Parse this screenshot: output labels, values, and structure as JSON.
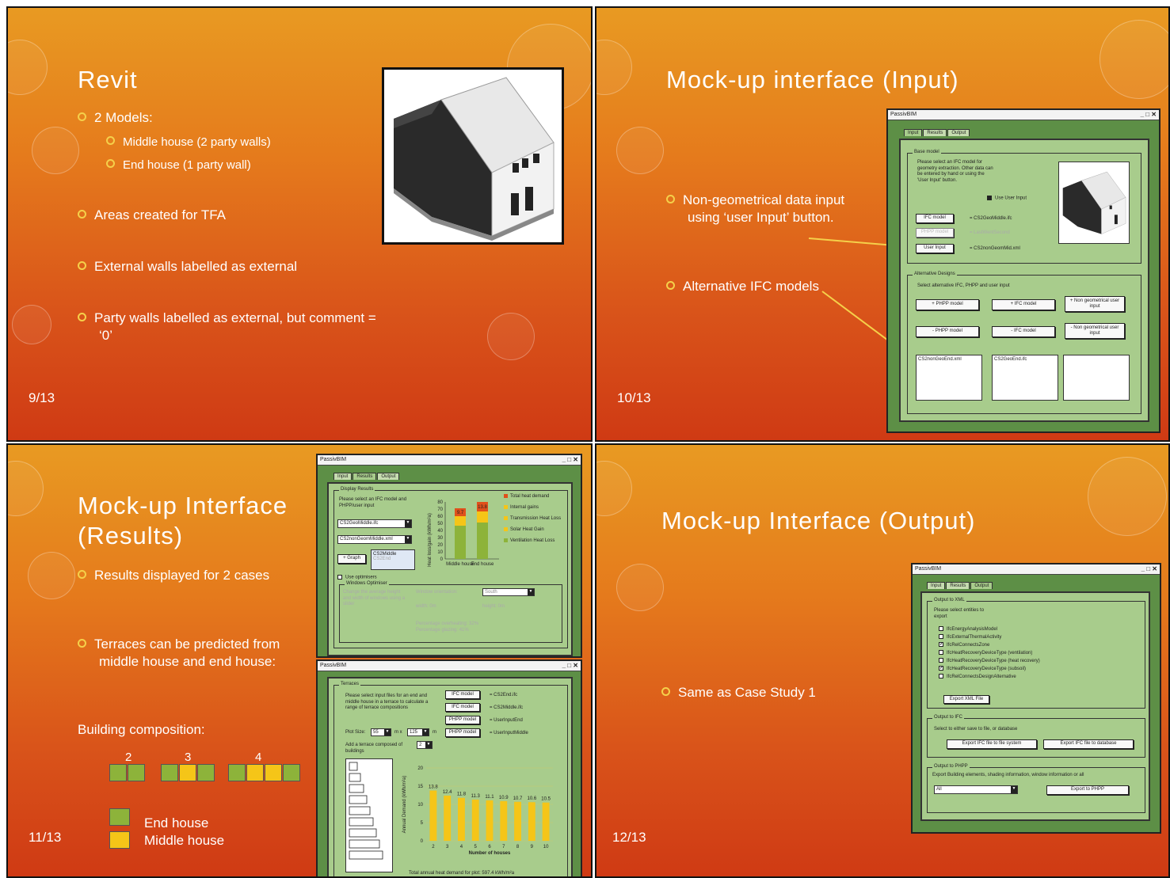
{
  "slide1": {
    "title": "Revit",
    "bullets": [
      "2 Models:",
      "Areas created for TFA",
      "External walls labelled as external",
      "Party walls labelled as external, but comment = ‘0’"
    ],
    "sub_bullets": [
      "Middle house (2 party walls)",
      "End house (1 party wall)"
    ],
    "page": "9/13"
  },
  "slide2": {
    "title": "Mock-up interface (Input)",
    "bullets": [
      "Non-geometrical data input using ‘user Input’ button.",
      "Alternative IFC models"
    ],
    "page": "10/13",
    "window": {
      "app": "PassivBIM",
      "controls": "_ □ ✕",
      "tabs": [
        "Input",
        "Results",
        "Output"
      ],
      "base_group": "Base model",
      "base_text": "Please select an IFC model for geometry extraction. Other data can be entered by hand or using the 'User Input' button.",
      "use_user_input": "Use User Input",
      "ifc_btn": "IFC model",
      "ifc_val": "= CS2GeoMiddle.ifc",
      "phpp_btn": "PHPP model",
      "phpp_val": "= LastWentSecond",
      "user_btn": "User Input",
      "user_val": "= CS2nonGeomMid.xml",
      "alt_group": "Alternative Designs",
      "alt_text": "Select alternative IFC, PHPP and user input",
      "add_phpp": "+ PHPP model",
      "add_ifc": "+ IFC model",
      "add_ng": "+ Non geometrical user input",
      "rem_phpp": "- PHPP model",
      "rem_ifc": "- IFC model",
      "rem_ng": "- Non geometrical user input",
      "list1": "CS2nonGeoEnd.xml",
      "list2": "CS2GeoEnd.ifc"
    }
  },
  "slide3": {
    "title_line1": "Mock-up Interface",
    "title_line2": "(Results)",
    "bullets": [
      "Results displayed for 2 cases",
      "Terraces can be predicted from middle house and end house:"
    ],
    "composition_label": "Building composition:",
    "comp_numbers": [
      "2",
      "3",
      "4"
    ],
    "legend": [
      "End house",
      "Middle house"
    ],
    "legend_colors": [
      "#8db33a",
      "#f5c518"
    ],
    "page": "11/13",
    "win1": {
      "app": "PassivBIM",
      "controls": "_ □ ✕",
      "tabs": [
        "Input",
        "Results",
        "Output"
      ],
      "group": "Display Results",
      "text": "Please select an IFC model and PHPP/user input",
      "sel1": "CS2GeoMiddle.ifc",
      "sel2": "CS2nonGeomMiddle.xml",
      "graph_btn": "+ Graph",
      "list_a": "CS2Middle",
      "list_b": "CS2End",
      "use_opt": "Use optimisers",
      "opt_group": "Windows Optimiser",
      "opt_text": "Change the average height and width of windows using a slider",
      "orient_label": "Window orientation:",
      "orient_val": "South",
      "width_label": "width: 0m",
      "height_label": "height: 0m",
      "pct_overheat": "Percentage overheating: 32%",
      "pct_glazing": "Percentage glazing: 41%",
      "ylabel": "Heat loss/gain (kWh/m²a)",
      "yticks": [
        "80",
        "70",
        "60",
        "50",
        "40",
        "30",
        "20",
        "10",
        "0"
      ],
      "categories": [
        "Middle house",
        "End house"
      ],
      "bar_labels": [
        "9.7",
        "13.8"
      ],
      "legend": [
        "Total heat demand",
        "Internal gains",
        "Transmission Heat Loss",
        "Solar Heat Gain",
        "Ventilation Heat Loss"
      ],
      "legend_colors": [
        "#e0501b",
        "#f5c518",
        "#f5c518",
        "#f5c518",
        "#8db33a"
      ]
    },
    "win2": {
      "app": "PassivBIM",
      "controls": "_ □ ✕",
      "group": "Terraces",
      "text": "Please select input files for an end and middle house in a terrace to calculate a range of terrace compositions",
      "ifc1_btn": "IFC model",
      "ifc1_val": "= CS2End.ifc",
      "ifc2_btn": "IFC model",
      "ifc2_val": "= CS2Middle.ifc",
      "phpp1_btn": "PHPP model",
      "phpp1_val": "= UserInputEnd",
      "phpp2_btn": "PHPP model",
      "phpp2_val": "= UserInputMiddle",
      "plot_label": "Plot Size:",
      "plot_w": "55",
      "plot_x": "m x",
      "plot_h": "125",
      "plot_unit": "m",
      "add_label": "Add a terrace composed of",
      "add_val": "2",
      "add_unit": "buildings",
      "footer": "Total annual heat demand for plot: 597.4 kWh/m²a"
    }
  },
  "chart_data": {
    "type": "bar",
    "categories": [
      "2",
      "3",
      "4",
      "5",
      "6",
      "7",
      "8",
      "9",
      "10"
    ],
    "values": [
      13.8,
      12.4,
      11.8,
      11.3,
      11.1,
      10.9,
      10.7,
      10.6,
      10.5
    ],
    "xlabel": "Number of houses",
    "ylabel": "Annual Demand (kWh/m²a)",
    "ylim": [
      0,
      20
    ],
    "yticks": [
      "20",
      "15",
      "10",
      "5",
      "0"
    ],
    "bar_color": "#f5c518"
  },
  "slide4": {
    "title": "Mock-up Interface (Output)",
    "bullets": [
      "Same as Case Study 1"
    ],
    "page": "12/13",
    "window": {
      "app": "PassivBIM",
      "controls": "_ □ ✕",
      "tabs": [
        "Input",
        "Results",
        "Output"
      ],
      "xml_group": "Output to XML",
      "xml_text": "Please select entities to export",
      "entities": [
        {
          "label": "IfcEnergyAnalysisModel",
          "checked": false
        },
        {
          "label": "IfcExternalThermalActivity",
          "checked": false
        },
        {
          "label": "IfcRelConnectsZone",
          "checked": true
        },
        {
          "label": "IfcHeatRecoveryDeviceType (ventilation)",
          "checked": false
        },
        {
          "label": "IfcHeatRecoveryDeviceType (heat recovery)",
          "checked": false
        },
        {
          "label": "IfcHeatRecoveryDeviceType (subsoil)",
          "checked": true
        },
        {
          "label": "IfcRelConnectsDesignAlternative",
          "checked": false
        }
      ],
      "export_xml": "Export XML File",
      "ifc_group": "Output to IFC",
      "ifc_text": "Select to either save to file, or database",
      "export_ifc_file": "Export IFC file to file system",
      "export_ifc_db": "Export IFC file to database",
      "phpp_group": "Output to PHPP",
      "phpp_text": "Export Building elements, shading information, window information or all",
      "phpp_sel": "All",
      "export_phpp": "Export to PHPP"
    }
  }
}
